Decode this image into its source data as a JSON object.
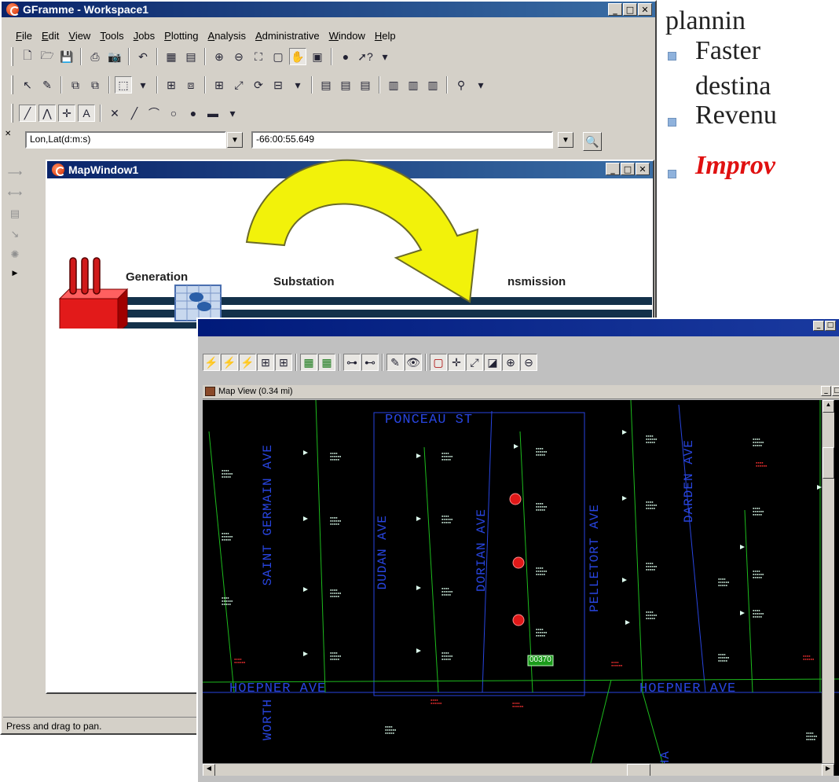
{
  "colors": {
    "title_active": "#0a246a",
    "map_bg": "#000000",
    "street_label": "#2845e0",
    "feeder": "#1dbb1d",
    "bullet": "#8fb2dc",
    "arrow": "#ffff00"
  },
  "slide": {
    "bullets": [
      {
        "text": "plannin"
      },
      {
        "text": "Faster"
      },
      {
        "text": "destina"
      },
      {
        "text": "Revenu"
      },
      {
        "text": "Improv"
      }
    ]
  },
  "main_window": {
    "title": "GFramme - Workspace1",
    "menu": [
      "File",
      "Edit",
      "View",
      "Tools",
      "Jobs",
      "Plotting",
      "Analysis",
      "Administrative",
      "Window",
      "Help"
    ],
    "coord_system": "Lon,Lat(d:m:s)",
    "coord_value": "-66:00:55.649",
    "status": "Press and drag to pan."
  },
  "map_window": {
    "title": "MapWindow1"
  },
  "diagram": {
    "generation_label": "Generation",
    "substation_label": "Substation",
    "transmission_label": "nsmission"
  },
  "map_view_window": {
    "title": "",
    "inner_title": "Map View  (0.34 mi)",
    "feature_tag": "00370",
    "streets": {
      "ponceau": "PONCEAU ST",
      "saint_germain": "SAINT GERMAIN AVE",
      "dudan": "DUDAN AVE",
      "dorian": "DORIAN AVE",
      "pelletort": "PELLETORT AVE",
      "darden": "DARDEN AVE",
      "hoepner_left": "HOEPNER AVE",
      "hoepner_right": "HOEPNER AVE",
      "worth": "WORTH",
      "ha": "HA"
    }
  }
}
